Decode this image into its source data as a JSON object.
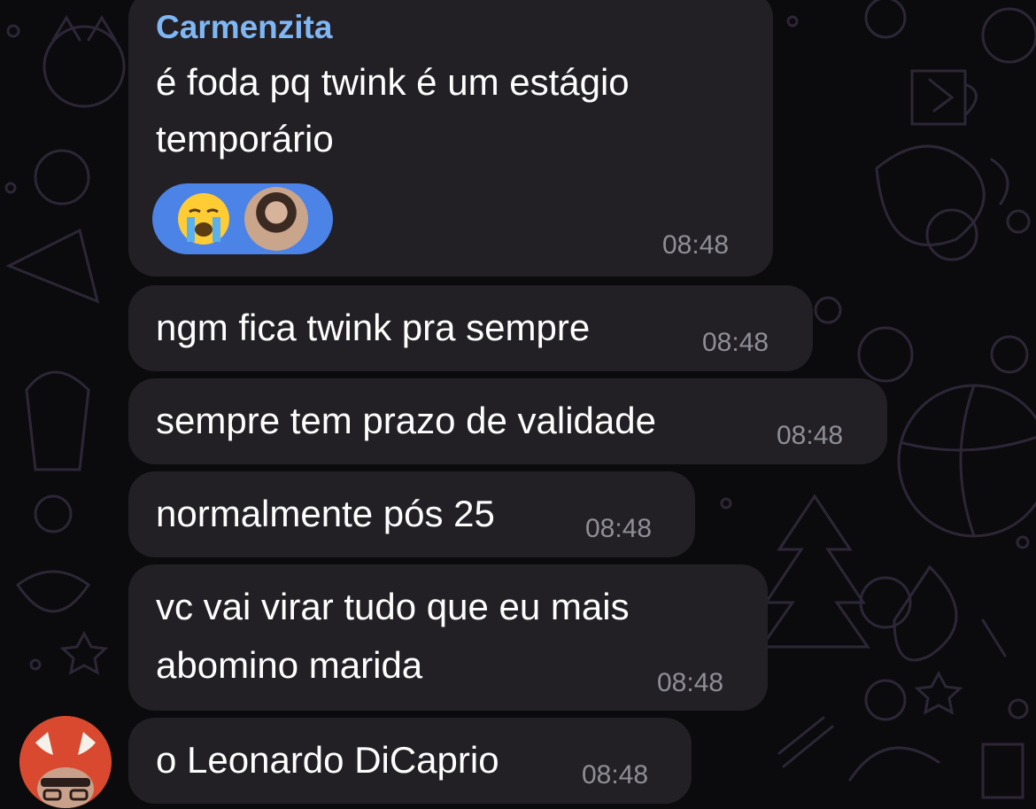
{
  "chat": {
    "sender_name": "Carmenzita",
    "messages": [
      {
        "lines": [
          "é foda pq twink é um estágio",
          "temporário"
        ],
        "time": "08:48",
        "reaction": "😭"
      },
      {
        "lines": [
          "ngm fica twink pra sempre"
        ],
        "time": "08:48"
      },
      {
        "lines": [
          "sempre tem prazo de validade"
        ],
        "time": "08:48"
      },
      {
        "lines": [
          "normalmente pós 25"
        ],
        "time": "08:48"
      },
      {
        "lines": [
          "vc vai virar tudo que eu mais",
          "abomino marida"
        ],
        "time": "08:48"
      },
      {
        "lines": [
          "o Leonardo DiCaprio"
        ],
        "time": "08:48"
      }
    ]
  },
  "colors": {
    "bubble": "#222024",
    "sender_name": "#7fb6f4",
    "timestamp": "#8f8e96",
    "reaction_pill": "#4c83e6",
    "avatar": "#d9492f"
  },
  "icons": [
    "crying-face-emoji",
    "reactor-avatar",
    "sender-avatar-devil"
  ]
}
